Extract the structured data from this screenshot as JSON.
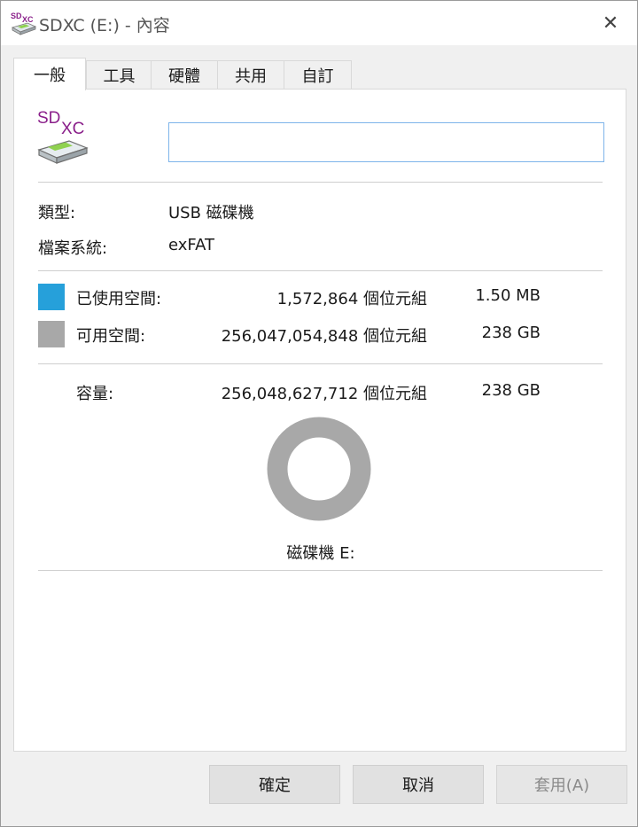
{
  "window": {
    "title": "SDXC (E:) - 內容",
    "close_glyph": "✕",
    "icon": "sdxc-drive-icon",
    "icon_text": "SDXC"
  },
  "tabs": [
    {
      "label": "一般",
      "active": true
    },
    {
      "label": "工具",
      "active": false
    },
    {
      "label": "硬體",
      "active": false
    },
    {
      "label": "共用",
      "active": false
    },
    {
      "label": "自訂",
      "active": false
    }
  ],
  "general": {
    "drive_icon_text_sd": "SD",
    "drive_icon_text_xc": "XC",
    "volume_name_value": "",
    "type_label": "類型:",
    "type_value": "USB 磁碟機",
    "filesystem_label": "檔案系統:",
    "filesystem_value": "exFAT",
    "used": {
      "label": "已使用空間:",
      "bytes": "1,572,864 個位元組",
      "size": "1.50 MB",
      "color": "#26a0da"
    },
    "free": {
      "label": "可用空間:",
      "bytes": "256,047,054,848 個位元組",
      "size": "238 GB",
      "color": "#a8a8a8"
    },
    "capacity": {
      "label": "容量:",
      "bytes": "256,048,627,712 個位元組",
      "size": "238 GB"
    },
    "used_fraction": 6.1e-06,
    "drive_caption": "磁碟機 E:"
  },
  "buttons": {
    "ok": "確定",
    "cancel": "取消",
    "apply": "套用(A)"
  }
}
